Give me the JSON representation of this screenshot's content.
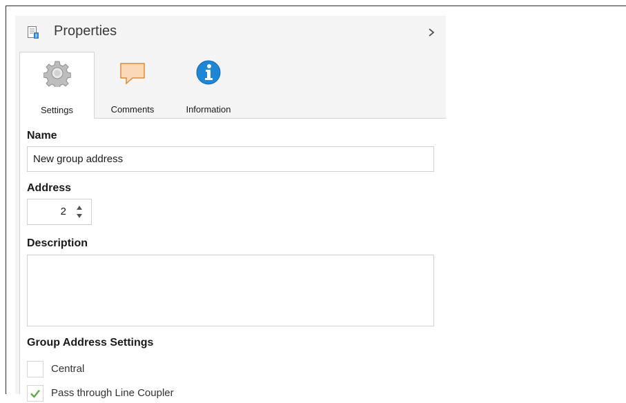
{
  "panel": {
    "title": "Properties",
    "tabs": [
      {
        "label": "Settings",
        "icon": "gear-icon",
        "active": true
      },
      {
        "label": "Comments",
        "icon": "comment-icon",
        "active": false
      },
      {
        "label": "Information",
        "icon": "info-icon",
        "active": false
      }
    ]
  },
  "settings": {
    "name_label": "Name",
    "name_value": "New group address",
    "address_label": "Address",
    "address_value": "2",
    "description_label": "Description",
    "description_value": "",
    "group_settings_label": "Group Address Settings",
    "central_label": "Central",
    "central_checked": false,
    "pass_through_label": "Pass through Line Coupler",
    "pass_through_checked": true
  },
  "colors": {
    "panel_bg": "#f4f4f4",
    "info_blue": "#1f86d6",
    "check_green": "#5cae3f",
    "comment_fill": "#fcd9b6",
    "comment_stroke": "#e08a3c"
  }
}
